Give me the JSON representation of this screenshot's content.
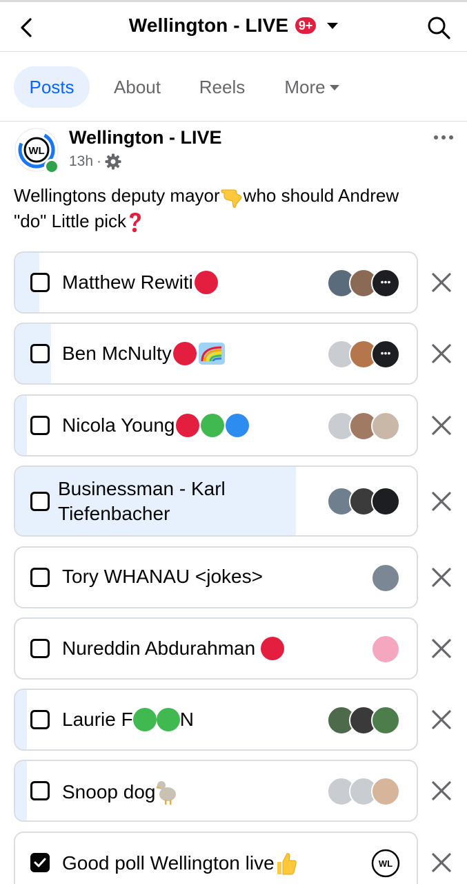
{
  "header": {
    "title": "Wellington - LIVE",
    "notification_count": "9+",
    "back_icon": "chevron-left-icon",
    "search_icon": "search-icon"
  },
  "tabs": [
    {
      "label": "Posts",
      "active": true
    },
    {
      "label": "About",
      "active": false
    },
    {
      "label": "Reels",
      "active": false
    },
    {
      "label": "More",
      "active": false
    }
  ],
  "post": {
    "page_name": "Wellington - LIVE",
    "avatar_text": "WL",
    "time": "13h",
    "audience_icon": "gear-icon",
    "text_line1_a": "Wellingtons deputy mayor",
    "text_line1_b": "who should Andrew",
    "text_line2": "\"do\" Little pick"
  },
  "poll": {
    "options": [
      {
        "label": "Matthew Rewiti",
        "checked": false,
        "fill": 0.06
      },
      {
        "label": "Ben McNulty",
        "checked": false,
        "fill": 0.09
      },
      {
        "label": "Nicola Young",
        "checked": false,
        "fill": 0.03
      },
      {
        "label": "Businessman - Karl Tiefenbacher",
        "checked": false,
        "fill": 0.7
      },
      {
        "label": "Tory WHANAU <jokes>",
        "checked": false,
        "fill": 0.0
      },
      {
        "label": "Nureddin Abdurahman",
        "checked": false,
        "fill": 0.0
      },
      {
        "label": "Laurie F",
        "label_end": "N",
        "checked": false,
        "fill": 0.03
      },
      {
        "label": "Snoop dog",
        "checked": false,
        "fill": 0.03
      },
      {
        "label": "Good poll Wellington live",
        "checked": true,
        "fill": 0.0
      }
    ],
    "voter_badge_text": "WL"
  },
  "colors": {
    "accent": "#0866ff",
    "tab_active_bg": "#e7f0fc",
    "poll_fill": "#e7f1fd",
    "badge_red": "#e41e3f",
    "online_green": "#31a24c",
    "secondary_text": "#65676b"
  }
}
